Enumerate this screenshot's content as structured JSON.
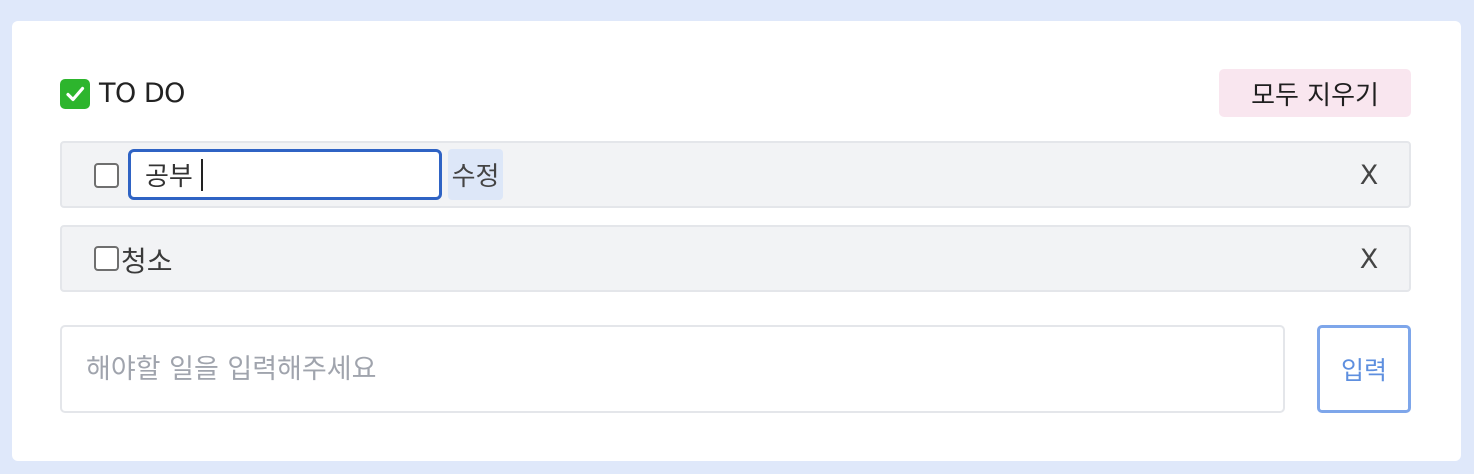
{
  "header": {
    "title": "TO DO",
    "title_icon": "check-mark-button-icon",
    "clear_all_label": "모두 지우기"
  },
  "todos": [
    {
      "text": "공부",
      "checked": false,
      "editing": true,
      "edit_value": "공부",
      "save_edit_label": "수정",
      "delete_label": "X"
    },
    {
      "text": "청소",
      "checked": false,
      "editing": false,
      "delete_label": "X"
    }
  ],
  "new_todo": {
    "placeholder": "해야할 일을 입력해주세요",
    "value": "",
    "submit_label": "입력"
  },
  "colors": {
    "background": "#dfe8fa",
    "card": "#ffffff",
    "clear_button_bg": "#f9e6ef",
    "todo_item_bg": "#f2f3f5",
    "edit_input_border": "#2f63c4",
    "edit_button_bg": "#dde7f8",
    "submit_border": "#7ea6ea",
    "submit_text": "#5e8fdf",
    "check_emoji_bg": "#2db52d"
  }
}
